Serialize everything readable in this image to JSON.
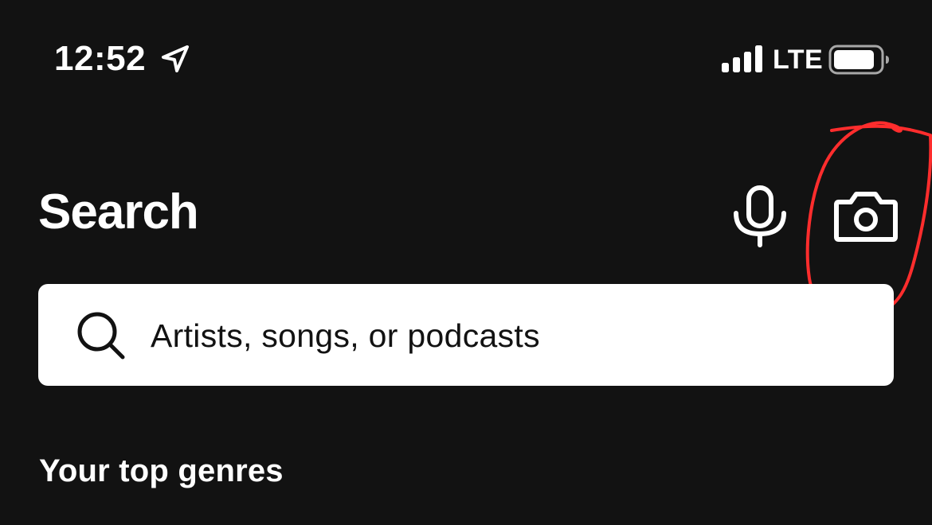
{
  "status_bar": {
    "time": "12:52",
    "network": "LTE",
    "location_icon": "location-arrow-icon",
    "signal_icon": "cellular-signal-icon",
    "battery_icon": "battery-icon"
  },
  "header": {
    "title": "Search",
    "mic_icon": "microphone-icon",
    "camera_icon": "camera-icon"
  },
  "search": {
    "placeholder": "Artists, songs, or podcasts",
    "icon": "search-icon"
  },
  "sections": {
    "top_genres_heading": "Your top genres"
  },
  "colors": {
    "background": "#121212",
    "text": "#ffffff",
    "search_field": "#ffffff",
    "annotation": "#ff2d2d"
  }
}
